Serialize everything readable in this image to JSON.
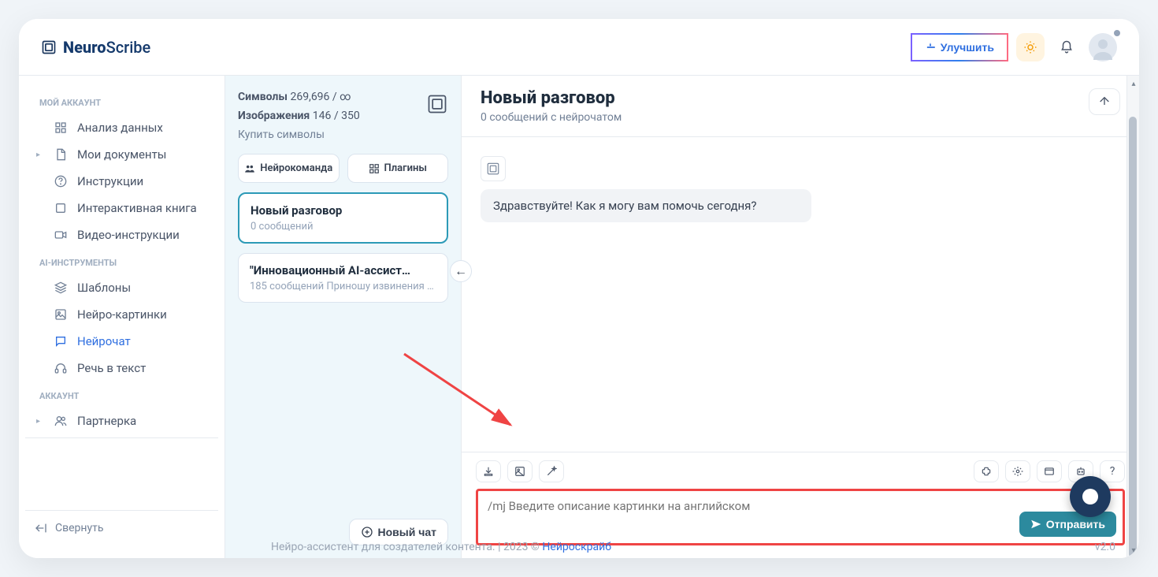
{
  "brand": {
    "bold": "Neuro",
    "light": "Scribe"
  },
  "topbar": {
    "upgrade": "Улучшить"
  },
  "sidebar": {
    "sections": {
      "account_title": "МОЙ АККАУНТ",
      "tools_title": "AI-ИНСТРУМЕНТЫ",
      "acct2_title": "АККАУНТ"
    },
    "items": {
      "analiz": "Анализ данных",
      "docs": "Мои документы",
      "instr": "Инструкции",
      "inter": "Интерактивная книга",
      "video": "Видео-инструкции",
      "tpl": "Шаблоны",
      "neuroimg": "Нейро-картинки",
      "neurochat": "Нейрочат",
      "speech": "Речь в текст",
      "partner": "Партнерка"
    },
    "collapse": "Свернуть"
  },
  "midcol": {
    "symbols_label": "Символы",
    "symbols_value": "269,696 / ∞",
    "images_label": "Изображения",
    "images_value": "146 / 350",
    "buy": "Купить символы",
    "team_btn": "Нейрокоманда",
    "plugins_btn": "Плагины",
    "conversations": [
      {
        "title": "Новый разговор",
        "sub": "0 сообщений"
      },
      {
        "title": "\"Инновационный AI-ассист…",
        "sub": "185 сообщений Приношу извинения …"
      }
    ],
    "newchat": "Новый чат"
  },
  "chat": {
    "title": "Новый разговор",
    "subtitle": "0 сообщений с нейрочатом",
    "greeting": "Здравствуйте! Как я могу вам помочь сегодня?",
    "placeholder": "/mj Введите описание картинки на английском",
    "send": "Отправить",
    "help_symbol": "?"
  },
  "footer": {
    "text_pre": "Нейро-ассистент для создателей контента.  | 2023 © ",
    "link": "Нейроскрайб",
    "version": "v2.0"
  }
}
